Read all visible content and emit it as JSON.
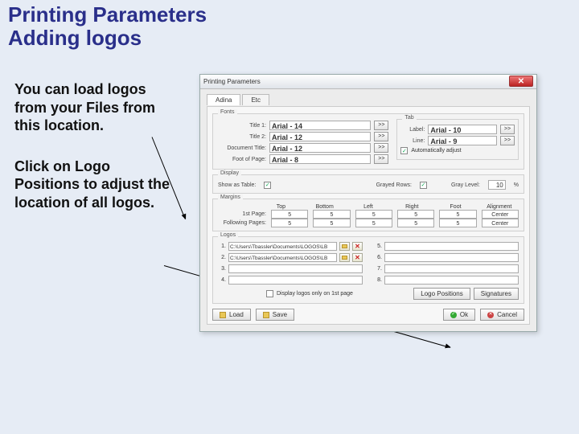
{
  "slide": {
    "title_line1": "Printing Parameters",
    "title_line2": "Adding logos",
    "para1": "You can load logos from your Files from this location.",
    "para2": "Click on Logo Positions to adjust the location of all logos."
  },
  "dialog": {
    "title": "Printing Parameters",
    "close_glyph": "✕",
    "tabs": {
      "active": "Adina",
      "other": "Etc"
    },
    "fonts": {
      "group_label": "Fonts",
      "title1": {
        "label": "Title 1:",
        "value": "Arial - 14",
        "btn": ">>"
      },
      "title2": {
        "label": "Title 2:",
        "value": "Arial - 12",
        "btn": ">>"
      },
      "doc_title": {
        "label": "Document Title:",
        "value": "Arial - 12",
        "btn": ">>"
      },
      "footer": {
        "label": "Foot of Page:",
        "value": "Arial - 8",
        "btn": ">>"
      },
      "tab_group": "Tab",
      "label": {
        "label": "Label:",
        "value": "Arial - 10",
        "btn": ">>"
      },
      "line": {
        "label": "Line:",
        "value": "Arial - 9",
        "btn": ">>"
      },
      "auto_check": "✓",
      "auto_label": "Automatically adjust"
    },
    "display": {
      "group_label": "Display",
      "show_as_tab_label": "Show as Table:",
      "show_as_tab_check": "✓",
      "grayed_rows_label": "Grayed Rows:",
      "grayed_rows_check": "✓",
      "gray_level_label": "Gray Level:",
      "gray_level_value": "10",
      "gray_level_pct": "%"
    },
    "margins": {
      "group_label": "Margins",
      "head": {
        "top": "Top",
        "bottom": "Bottom",
        "left": "Left",
        "right": "Right",
        "foot": "Foot",
        "align": "Alignment"
      },
      "first": {
        "label": "1st Page:",
        "top": "5",
        "bottom": "5",
        "left": "5",
        "right": "5",
        "foot": "5",
        "align": "Center"
      },
      "following": {
        "label": "Following Pages:",
        "top": "5",
        "bottom": "5",
        "left": "5",
        "right": "5",
        "foot": "5",
        "align": "Center"
      }
    },
    "logos": {
      "group_label": "Logos",
      "rows": {
        "r1": "C:\\Users\\Tbassler\\Documents\\LOGOS\\LB",
        "r2": "C:\\Users\\Tbassler\\Documents\\LOGOS\\LB",
        "r3": "",
        "r4": "",
        "r5": "",
        "r6": "",
        "r7": "",
        "r8": ""
      },
      "display_only_label": "Display logos only on 1st page",
      "logo_positions_btn": "Logo Positions",
      "signatures_btn": "Signatures"
    },
    "buttons": {
      "load": "Load",
      "save": "Save",
      "ok": "Ok",
      "cancel": "Cancel"
    }
  }
}
